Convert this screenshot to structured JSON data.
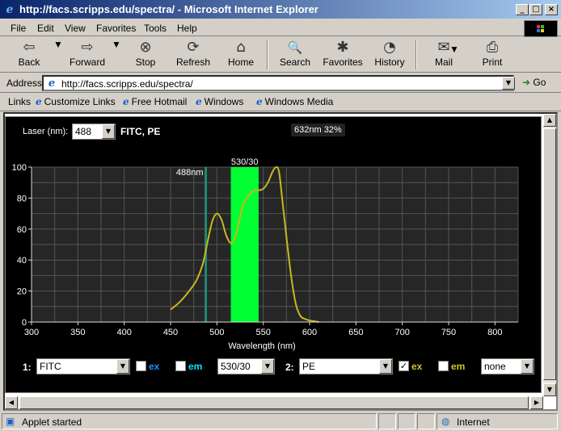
{
  "window": {
    "title": "http://facs.scripps.edu/spectra/ - Microsoft Internet Explorer",
    "buttons": [
      "_",
      "□",
      "×"
    ]
  },
  "menu": [
    "File",
    "Edit",
    "View",
    "Favorites",
    "Tools",
    "Help"
  ],
  "toolbar": [
    {
      "label": "Back",
      "icon": "⇦",
      "dropdown": true
    },
    {
      "label": "Forward",
      "icon": "⇨",
      "dropdown": true
    },
    {
      "label": "Stop",
      "icon": "⊗"
    },
    {
      "label": "Refresh",
      "icon": "⟳"
    },
    {
      "label": "Home",
      "icon": "⌂"
    },
    {
      "label": "Search",
      "icon": "🔍"
    },
    {
      "label": "Favorites",
      "icon": "✱"
    },
    {
      "label": "History",
      "icon": "◔"
    },
    {
      "label": "Mail",
      "icon": "✉",
      "dropdown": true
    },
    {
      "label": "Print",
      "icon": "⎙"
    }
  ],
  "address": {
    "label": "Address",
    "url": "http://facs.scripps.edu/spectra/",
    "go_label": "Go"
  },
  "links": {
    "label": "Links",
    "items": [
      "Customize Links",
      "Free Hotmail",
      "Windows",
      "Windows Media"
    ]
  },
  "applet": {
    "laser_label": "Laser (nm):",
    "laser_value": "488",
    "dyes_title": "FITC, PE",
    "readout": "632nm 32%",
    "laser_line_label": "488nm",
    "filter_label": "530/30",
    "row": {
      "slot1_label": "1:",
      "slot1_dye": "FITC",
      "slot1_ex": "ex",
      "slot1_em": "em",
      "slot1_ex_checked": false,
      "slot1_em_checked": false,
      "filter1": "530/30",
      "slot2_label": "2:",
      "slot2_dye": "PE",
      "slot2_ex": "ex",
      "slot2_em": "em",
      "slot2_ex_checked": true,
      "slot2_em_checked": false,
      "filter2": "none"
    }
  },
  "colors": {
    "ex_label_1": "#1e90ff",
    "em_label_1": "#00e5ff",
    "ex_label_2": "#d4c420",
    "em_label_2": "#d4c420",
    "curve": "#c8b820",
    "laser_line": "#1f8a76",
    "filter_band": "#00ff33"
  },
  "chart_data": {
    "type": "line",
    "xlabel": "Wavelength (nm)",
    "ylabel": "",
    "xlim": [
      300,
      825
    ],
    "ylim": [
      0,
      100
    ],
    "xticks": [
      300,
      350,
      400,
      450,
      500,
      550,
      600,
      650,
      700,
      750,
      800
    ],
    "yticks": [
      0,
      20,
      40,
      60,
      80,
      100
    ],
    "grid": true,
    "laser_nm": 488,
    "filter_band": {
      "center": 530,
      "width": 30
    },
    "series": [
      {
        "name": "PE ex",
        "x": [
          450,
          460,
          470,
          478,
          485,
          490,
          495,
          500,
          505,
          510,
          515,
          520,
          525,
          530,
          540,
          545,
          550,
          555,
          560,
          564,
          567,
          570,
          575,
          580,
          585,
          590,
          595,
          600,
          610
        ],
        "values": [
          8,
          13,
          20,
          27,
          38,
          52,
          65,
          70,
          66,
          56,
          51,
          55,
          68,
          78,
          85,
          85,
          86,
          90,
          97,
          100,
          97,
          82,
          55,
          30,
          12,
          4,
          2,
          1,
          0
        ]
      }
    ]
  },
  "status": {
    "text": "Applet started",
    "zone": "Internet"
  }
}
